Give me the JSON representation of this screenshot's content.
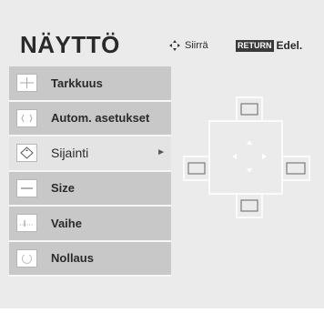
{
  "title": "NÄYTTÖ",
  "hints": {
    "move_label": "Siirrä",
    "return_badge": "RETURN",
    "return_label": "Edel."
  },
  "menu": {
    "items": [
      {
        "label": "Tarkkuus",
        "icon": "resolution-icon"
      },
      {
        "label": "Autom. asetukset",
        "icon": "auto-config-icon"
      },
      {
        "label": "Sijainti",
        "icon": "position-icon",
        "selected": true
      },
      {
        "label": "Size",
        "icon": "size-icon"
      },
      {
        "label": "Vaihe",
        "icon": "phase-icon"
      },
      {
        "label": "Nollaus",
        "icon": "reset-icon"
      }
    ]
  }
}
